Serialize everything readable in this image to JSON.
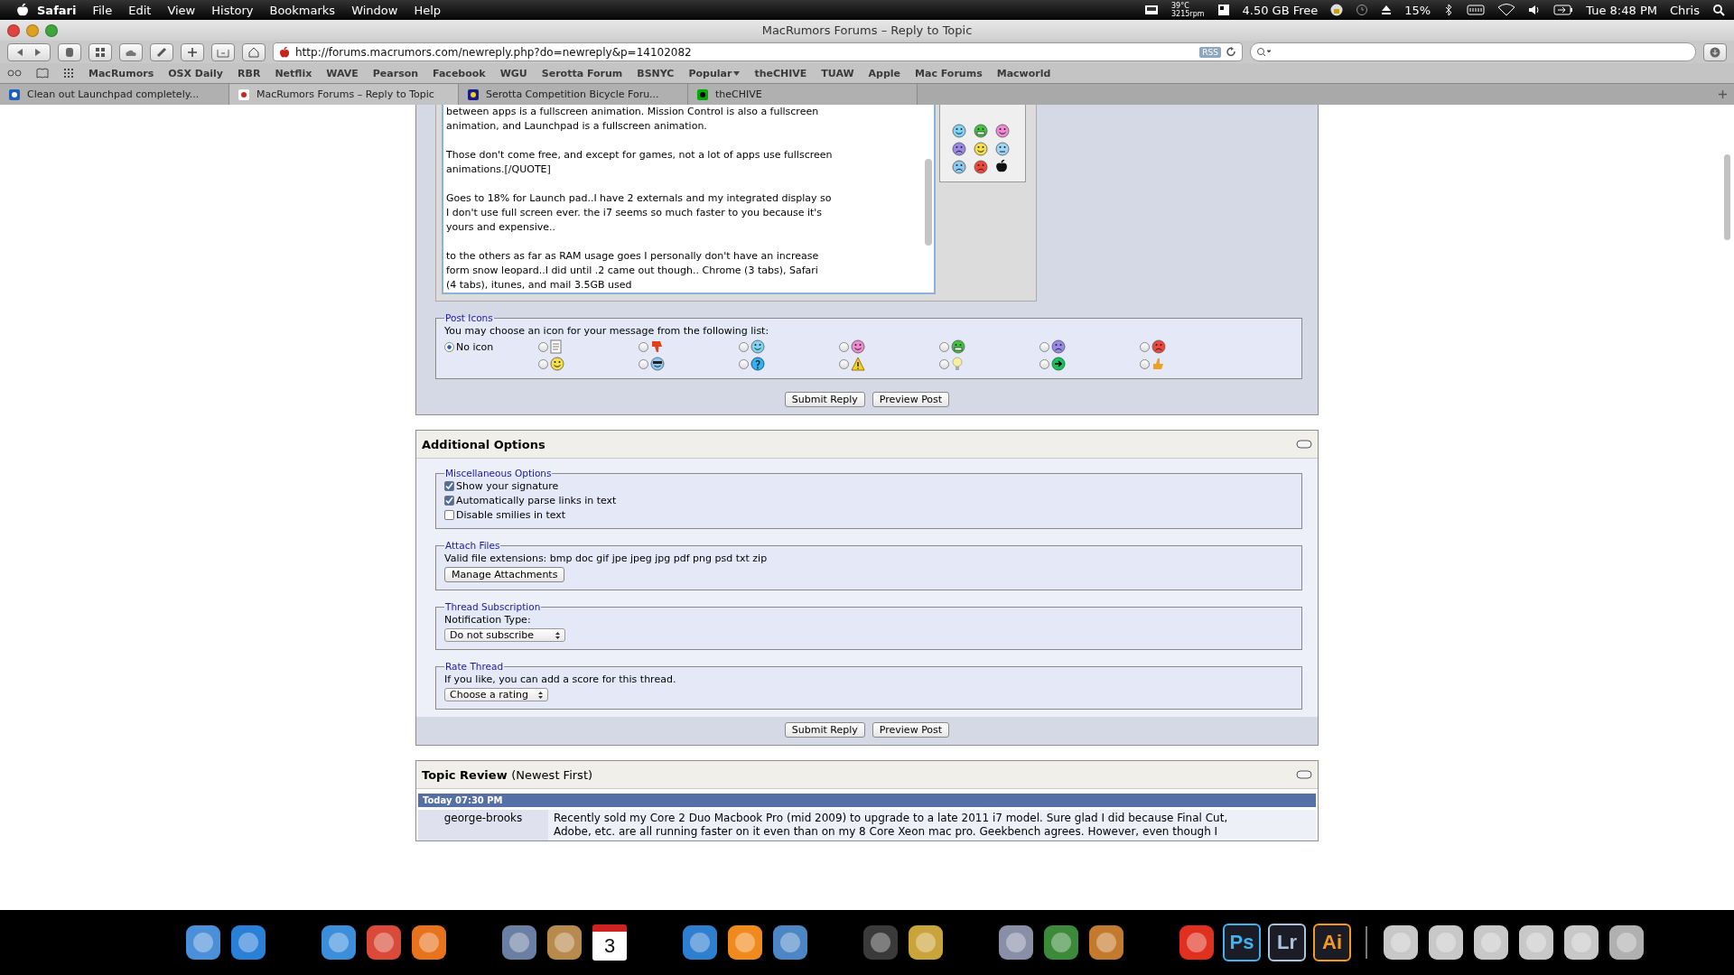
{
  "menu_bar": {
    "app": "Safari",
    "menus": [
      "File",
      "Edit",
      "View",
      "History",
      "Bookmarks",
      "Window",
      "Help"
    ],
    "temperature": "39°C",
    "fan": "3215rpm",
    "memory": "4.50 GB Free",
    "battery": "15%",
    "clock": "Tue 8:48 PM",
    "user": "Chris"
  },
  "window": {
    "title": "MacRumors Forums – Reply to Topic",
    "address": "http://forums.macrumors.com/newreply.php?do=newreply&p=14102082",
    "rss": "RSS"
  },
  "bookmarks": [
    {
      "label": "MacRumors",
      "kind": "link"
    },
    {
      "label": "OSX Daily",
      "kind": "link"
    },
    {
      "label": "RBR",
      "kind": "link"
    },
    {
      "label": "Netflix",
      "kind": "link"
    },
    {
      "label": "WAVE",
      "kind": "link"
    },
    {
      "label": "Pearson",
      "kind": "link"
    },
    {
      "label": "Facebook",
      "kind": "link"
    },
    {
      "label": "WGU",
      "kind": "link"
    },
    {
      "label": "Serotta Forum",
      "kind": "link"
    },
    {
      "label": "BSNYC",
      "kind": "link"
    },
    {
      "label": "Popular",
      "kind": "folder"
    },
    {
      "label": "theCHIVE",
      "kind": "link"
    },
    {
      "label": "TUAW",
      "kind": "link"
    },
    {
      "label": "Apple",
      "kind": "link"
    },
    {
      "label": "Mac Forums",
      "kind": "link"
    },
    {
      "label": "Macworld",
      "kind": "link"
    }
  ],
  "tabs": [
    {
      "label": "Clean out Launchpad completely...",
      "selected": false
    },
    {
      "label": "MacRumors Forums – Reply to Topic",
      "selected": true
    },
    {
      "label": "Serotta Competition Bicycle Foru...",
      "selected": false
    },
    {
      "label": "theCHIVE",
      "selected": false
    }
  ],
  "message": "between apps is a fullscreen animation. Mission Control is also a fullscreen\nanimation, and Launchpad is a fullscreen animation.\n\nThose don't come free, and except for games, not a lot of apps use fullscreen\nanimations.[/QUOTE]\n\nGoes to 18% for Launch pad..I have 2 externals and my integrated display so\nI don't use full screen ever. the i7 seems so much faster to you because it's\nyours and expensive..\n\nto the others as far as RAM usage goes I personally don't have an increase\nform snow leopard..I did until .2 came out though.. Chrome (3 tabs), Safari\n(4 tabs), itunes, and mail 3.5GB used",
  "post_icons": {
    "legend": "Post Icons",
    "prompt": "You may choose an icon for your message from the following list:",
    "options": [
      {
        "label": "No icon",
        "selected": true
      },
      {
        "selected": false
      },
      {
        "selected": false
      },
      {
        "selected": false
      },
      {
        "selected": false
      },
      {
        "selected": false
      },
      {
        "selected": false
      },
      {
        "selected": false
      },
      {
        "selected": false
      },
      {
        "selected": false
      },
      {
        "selected": false
      },
      {
        "selected": false
      },
      {
        "selected": false
      },
      {
        "selected": false
      },
      {
        "selected": false
      }
    ]
  },
  "reply_buttons": [
    "Submit Reply",
    "Preview Post"
  ],
  "additional_options": {
    "title": "Additional Options",
    "misc": {
      "legend": "Miscellaneous Options",
      "options": [
        {
          "label": "Show your signature",
          "checked": true
        },
        {
          "label": "Automatically parse links in text",
          "checked": true
        },
        {
          "label": "Disable smilies in text",
          "checked": false
        }
      ]
    },
    "attach": {
      "legend": "Attach Files",
      "text": "Valid file extensions: bmp doc gif jpe jpeg jpg pdf png psd txt zip",
      "button": "Manage Attachments"
    },
    "subscription": {
      "legend": "Thread Subscription",
      "label": "Notification Type:",
      "value": "Do not subscribe"
    },
    "rating": {
      "legend": "Rate Thread",
      "text": "If you like, you can add a score for this thread.",
      "value": "Choose a rating"
    },
    "buttons": [
      "Submit Reply",
      "Preview Post"
    ]
  },
  "topic_review": {
    "title": "Topic Review",
    "subtitle": "(Newest First)",
    "posts": [
      {
        "date": "Today 07:30 PM",
        "author": "george-brooks",
        "text": "Recently sold my Core 2 Duo Macbook Pro (mid 2009) to upgrade to a late 2011 i7 model. Sure glad I did because Final Cut,\nAdobe, etc. are all running faster on it even than on my 8 Core Xeon mac pro. Geekbench agrees. However, even though I"
      }
    ]
  },
  "dock": [
    {
      "kind": "gap"
    },
    {
      "kind": "app",
      "color": "#4a8fd8"
    },
    {
      "kind": "app",
      "color": "#2a7fd6"
    },
    {
      "kind": "gap"
    },
    {
      "kind": "app",
      "color": "#3c8edb"
    },
    {
      "kind": "app",
      "color": "#d94a38"
    },
    {
      "kind": "app",
      "color": "#e8731f"
    },
    {
      "kind": "gap"
    },
    {
      "kind": "app",
      "color": "#6a7fa3"
    },
    {
      "kind": "app",
      "color": "#b88a4e"
    },
    {
      "kind": "calendar",
      "label": "3"
    },
    {
      "kind": "gap"
    },
    {
      "kind": "app",
      "color": "#2f7fd0"
    },
    {
      "kind": "app",
      "color": "#f08a1c"
    },
    {
      "kind": "app",
      "color": "#4d86c5"
    },
    {
      "kind": "gap"
    },
    {
      "kind": "app",
      "color": "#3a3a3a"
    },
    {
      "kind": "app",
      "color": "#c9a43a"
    },
    {
      "kind": "gap"
    },
    {
      "kind": "app",
      "color": "#8a8fa8"
    },
    {
      "kind": "app",
      "color": "#3a8a3a"
    },
    {
      "kind": "app",
      "color": "#c47a2e"
    },
    {
      "kind": "gap"
    },
    {
      "kind": "app",
      "color": "#e03020"
    },
    {
      "kind": "tile",
      "label": "Ps",
      "color": "#3fb4f0"
    },
    {
      "kind": "tile",
      "label": "Lr",
      "color": "#a9c4dc"
    },
    {
      "kind": "tile",
      "label": "Ai",
      "color": "#f39a1e"
    },
    {
      "kind": "divider"
    },
    {
      "kind": "app",
      "color": "#c8c8c8"
    },
    {
      "kind": "app",
      "color": "#c8c8c8"
    },
    {
      "kind": "app",
      "color": "#c8c8c8"
    },
    {
      "kind": "app",
      "color": "#c8c8c8"
    },
    {
      "kind": "app",
      "color": "#c8c8c8"
    },
    {
      "kind": "app",
      "color": "#b0b0b0"
    }
  ]
}
